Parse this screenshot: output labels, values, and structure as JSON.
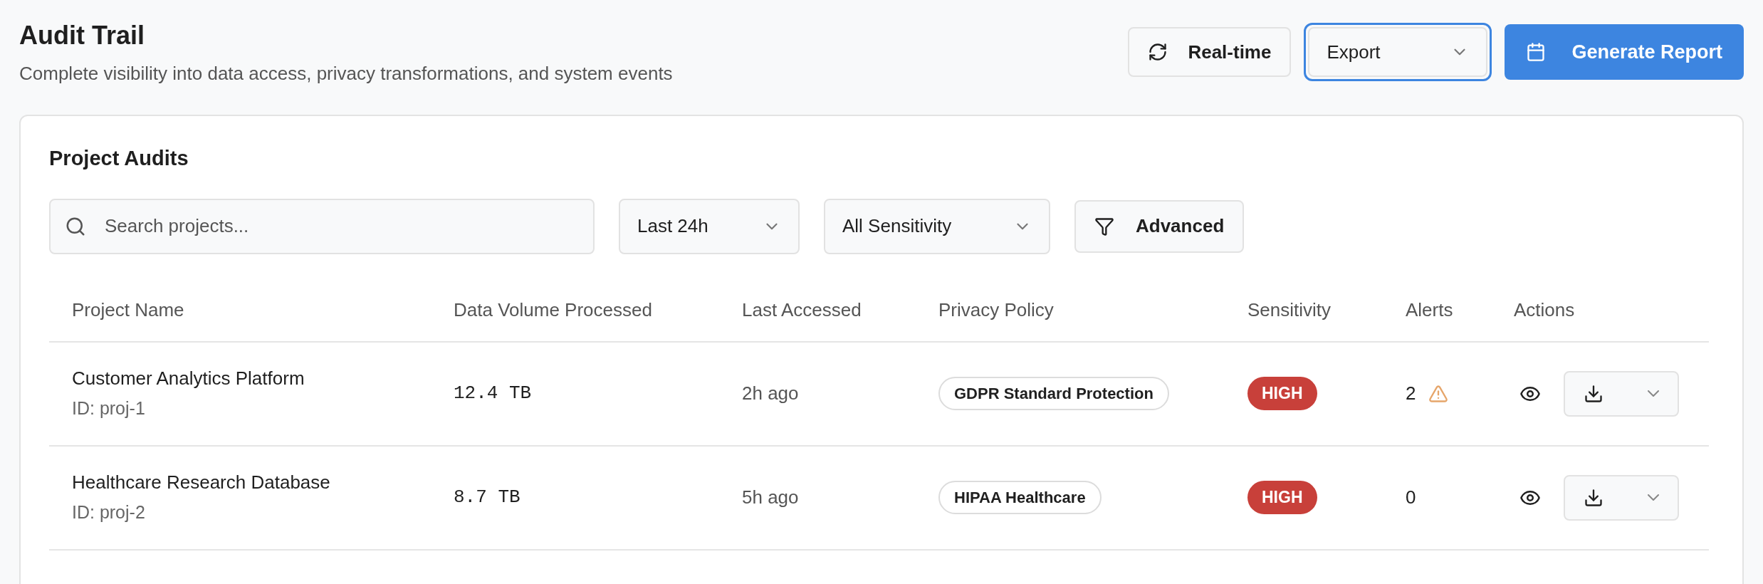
{
  "header": {
    "title": "Audit Trail",
    "subtitle": "Complete visibility into data access, privacy transformations, and system events"
  },
  "actions": {
    "realtime": "Real-time",
    "export": {
      "label": "Export",
      "focused": true
    },
    "generate": "Generate Report"
  },
  "card": {
    "title": "Project Audits",
    "filters": {
      "search": {
        "placeholder": "Search projects..."
      },
      "time": "Last 24h",
      "sensitivity": "All Sensitivity",
      "advanced": "Advanced"
    },
    "table": {
      "columns": [
        "Project Name",
        "Data Volume Processed",
        "Last Accessed",
        "Privacy Policy",
        "Sensitivity",
        "Alerts",
        "Actions"
      ],
      "rows": [
        {
          "name": "Customer Analytics Platform",
          "id": "ID: proj-1",
          "volume": "12.4 TB",
          "last_accessed": "2h ago",
          "policy": "GDPR Standard Protection",
          "sensitivity": "HIGH",
          "alerts": "2",
          "warning": true
        },
        {
          "name": "Healthcare Research Database",
          "id": "ID: proj-2",
          "volume": "8.7 TB",
          "last_accessed": "5h ago",
          "policy": "HIPAA Healthcare",
          "sensitivity": "HIGH",
          "alerts": "0",
          "warning": false
        }
      ]
    }
  }
}
